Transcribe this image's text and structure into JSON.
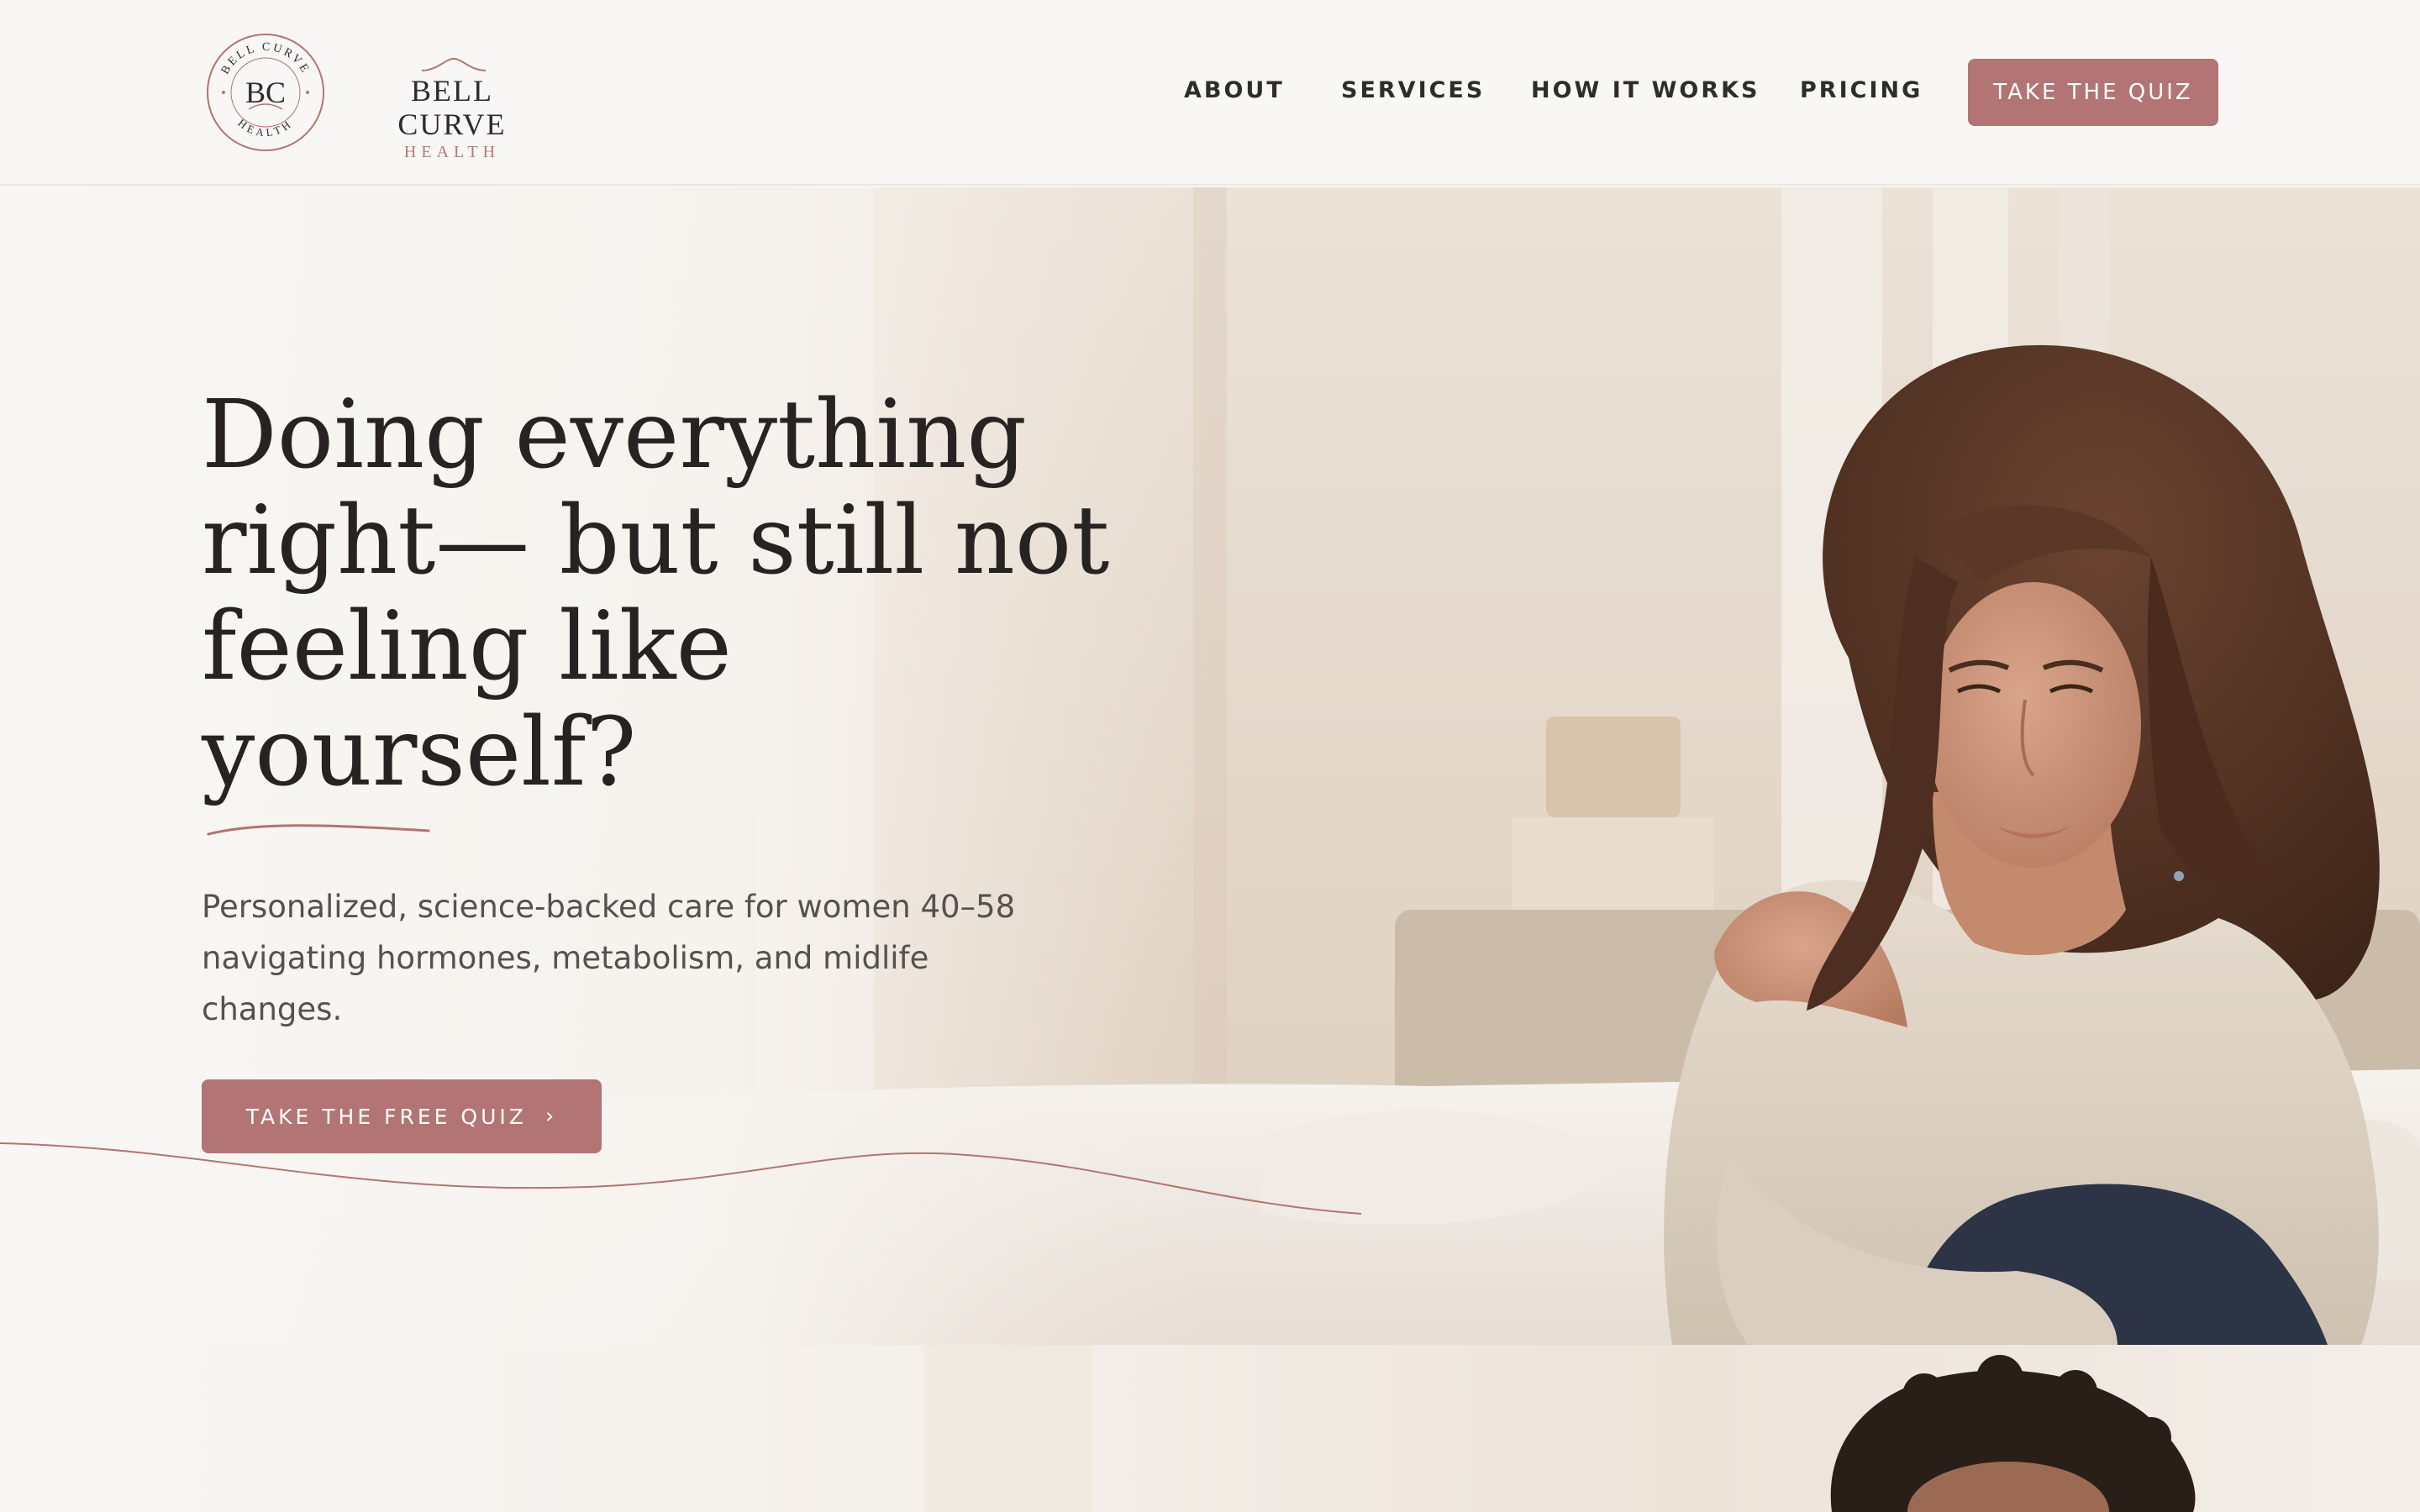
{
  "brand": {
    "emblem_monogram": "BC",
    "emblem_ring_top": "BELL CURVE",
    "emblem_ring_bottom": "HEALTH",
    "name_line1": "BELL CURVE",
    "name_line2": "HEALTH",
    "accent_color": "#b27474",
    "emblem_color": "#2c2a33"
  },
  "nav": {
    "items": [
      {
        "label": "ABOUT"
      },
      {
        "label": "SERVICES"
      },
      {
        "label": "HOW IT WORKS"
      },
      {
        "label": "PRICING"
      }
    ],
    "cta_label": "TAKE THE QUIZ"
  },
  "hero": {
    "headline_lines": [
      "Doing everything",
      "right— but still not",
      "feeling like",
      "yourself?"
    ],
    "subtext": "Personalized, science-backed care for women 40–58 navigating hormones, metabolism, and midlife changes.",
    "cta_label": "TAKE THE FREE QUIZ",
    "cta_icon": "chevron-right-icon",
    "cta_glyph": "›"
  },
  "colors": {
    "page_background": "#f7f6f4",
    "headline": "#262322",
    "body_text": "#55514e",
    "button": "#b27474"
  }
}
